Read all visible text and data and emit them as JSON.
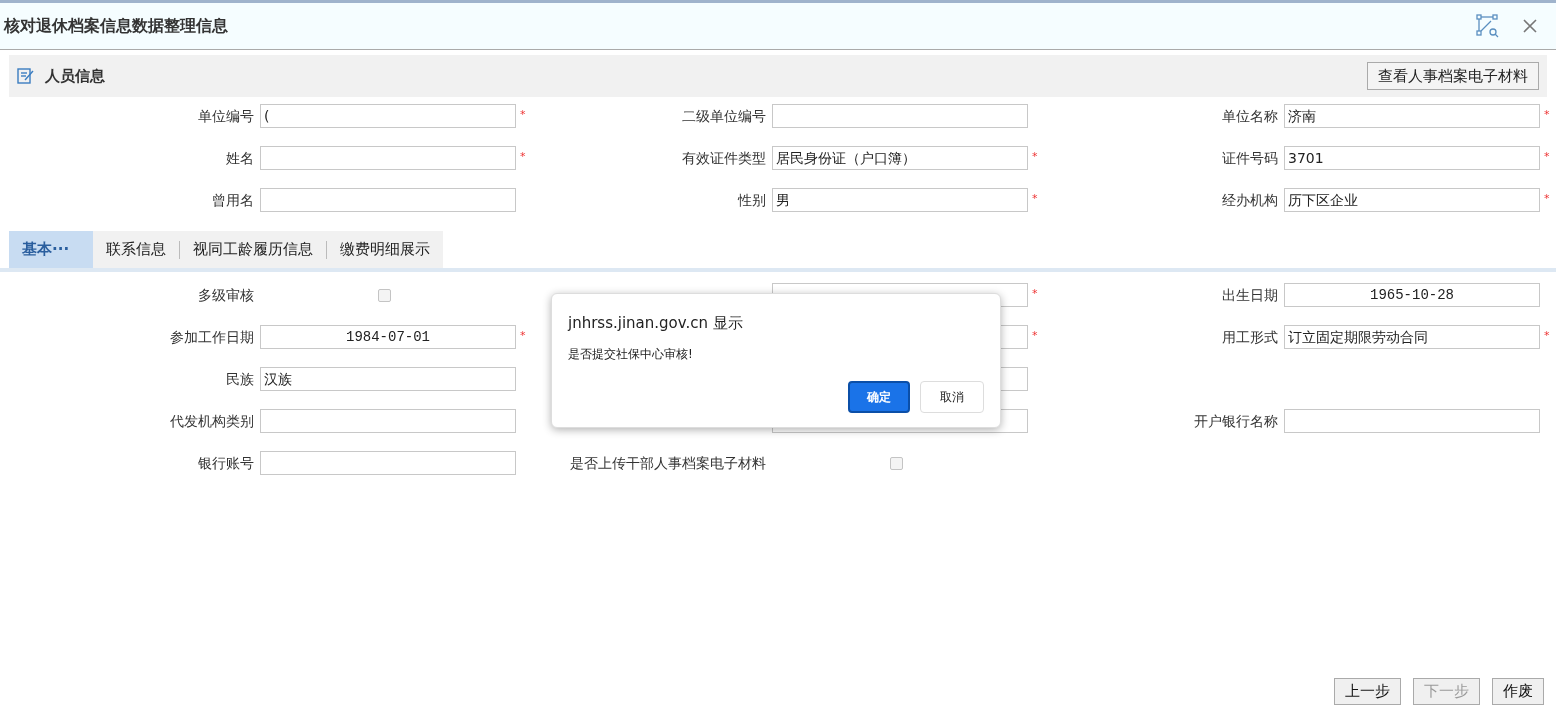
{
  "window": {
    "title": "核对退休档案信息数据整理信息"
  },
  "section": {
    "title": "人员信息",
    "button": "查看人事档案电子材料"
  },
  "top_fields": [
    {
      "kind": "text",
      "label": "单位编号",
      "value": "(",
      "required_mark": "*"
    },
    {
      "kind": "text",
      "label": "二级单位编号"
    },
    {
      "kind": "text",
      "label": "单位名称",
      "value": "济南",
      "required_mark": "*"
    },
    {
      "kind": "text",
      "label": "姓名",
      "required_mark": "*"
    },
    {
      "kind": "text",
      "label": "有效证件类型",
      "value": "居民身份证（户口簿）",
      "required_mark": "*"
    },
    {
      "kind": "text",
      "label": "证件号码",
      "value": "3701",
      "required_mark": "*"
    },
    {
      "kind": "text",
      "label": "曾用名"
    },
    {
      "kind": "text",
      "label": "性别",
      "value": "男",
      "required_mark": "*"
    },
    {
      "kind": "text",
      "label": "经办机构",
      "value": "历下区企业",
      "required_mark": "*"
    }
  ],
  "tabs": [
    {
      "label": "基本···",
      "selected": true
    },
    {
      "label": "联系信息",
      "selected": false
    },
    {
      "label": "视同工龄履历信息",
      "selected": false
    },
    {
      "label": "缴费明细展示",
      "selected": false
    }
  ],
  "fields": [
    {
      "kind": "checkbox",
      "label": "多级审核",
      "checked": false
    },
    {
      "kind": "text",
      "required_mark": "*"
    },
    {
      "kind": "date",
      "label": "出生日期",
      "value": "1965-10-28"
    },
    {
      "kind": "date",
      "label": "参加工作日期",
      "value": "1984-07-01",
      "required_mark": "*"
    },
    {
      "kind": "text",
      "required_mark": "*"
    },
    {
      "kind": "text",
      "label": "用工形式",
      "value": "订立固定期限劳动合同",
      "required_mark": "*"
    },
    {
      "kind": "text",
      "label": "民族",
      "value": "汉族"
    },
    {
      "kind": "text"
    },
    {
      "kind": "empty"
    },
    {
      "kind": "text",
      "label": "代发机构类别"
    },
    {
      "kind": "text"
    },
    {
      "kind": "text",
      "label": "开户银行名称"
    },
    {
      "kind": "text",
      "label": "银行账号"
    },
    {
      "kind": "checkbox",
      "label": "是否上传干部人事档案电子材料",
      "checked": false
    },
    {
      "kind": "empty"
    }
  ],
  "dialog": {
    "title": "jnhrss.jinan.gov.cn 显示",
    "message": "是否提交社保中心审核!",
    "ok": "确定",
    "cancel": "取消"
  },
  "footer_buttons": [
    {
      "label": "上一步",
      "disabled": false
    },
    {
      "label": "下一步",
      "disabled": true
    },
    {
      "label": "作废",
      "disabled": false
    }
  ]
}
